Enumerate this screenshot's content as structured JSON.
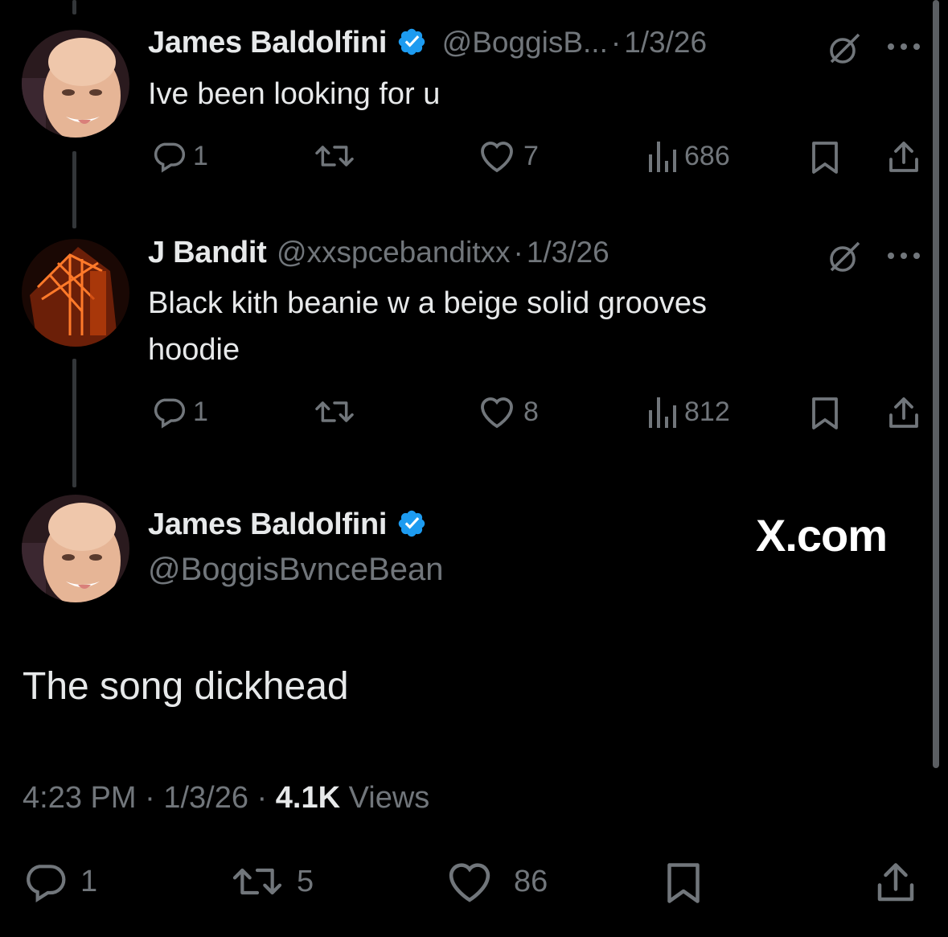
{
  "tweets": [
    {
      "author": "James Baldolfini",
      "handle": "@BoggisB...",
      "sep": "·",
      "date": "1/3/26",
      "text": "Ive been looking for u",
      "replies": "1",
      "likes": "7",
      "views": "686"
    },
    {
      "author": "J Bandit",
      "handle": "@xxspcebanditxx",
      "sep": "·",
      "date": "1/3/26",
      "text_line1": "Black kith beanie w a beige solid grooves",
      "text_line2": "hoodie",
      "replies": "1",
      "likes": "8",
      "views": "812"
    }
  ],
  "main_tweet": {
    "author": "James Baldolfini",
    "handle": "@BoggisBvnceBean",
    "brand": "X.com",
    "text": "The song dickhead",
    "time": "4:23 PM",
    "date": "1/3/26",
    "sep": "·",
    "views_count": "4.1K",
    "views_label": "Views",
    "replies": "1",
    "reposts": "5",
    "likes": "86"
  },
  "icons": [
    "verified-badge-icon",
    "grok-icon",
    "more-icon",
    "reply-icon",
    "repost-icon",
    "like-icon",
    "views-icon",
    "bookmark-icon",
    "share-icon"
  ],
  "colors": {
    "background": "#000000",
    "text": "#e7e9ea",
    "muted": "#71767b",
    "verified": "#1d9bf0",
    "thread_line": "#333639"
  }
}
